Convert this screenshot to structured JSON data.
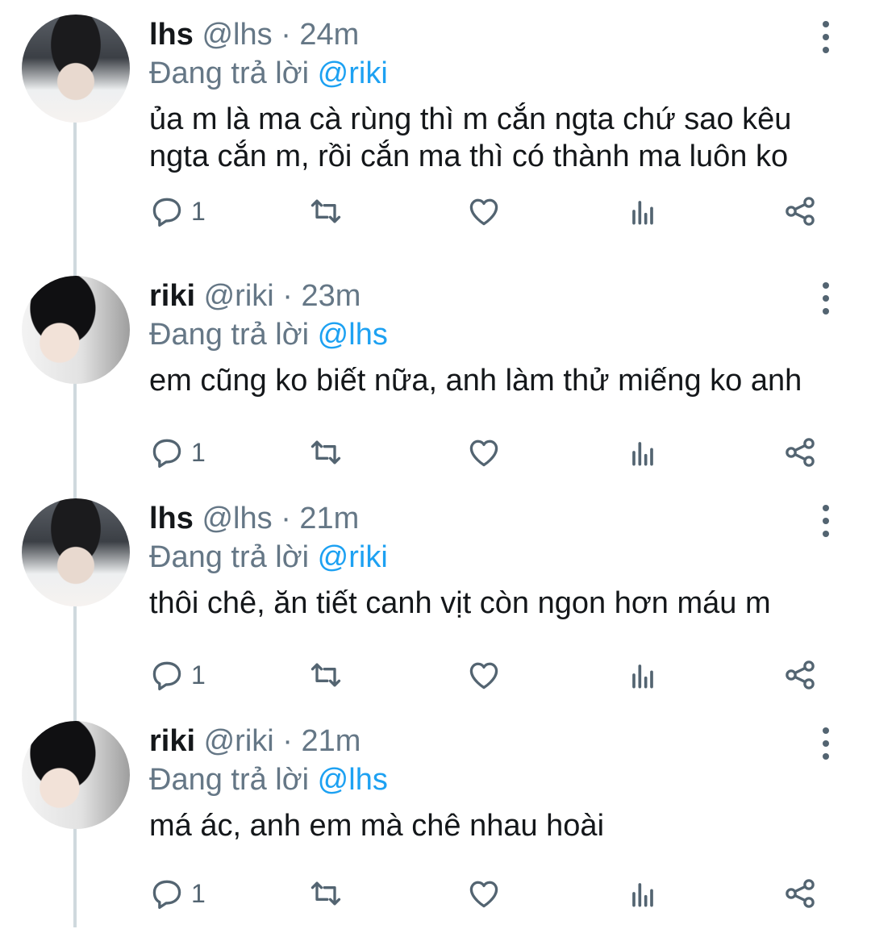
{
  "tweets": [
    {
      "name": "lhs",
      "handle": "@lhs",
      "time": "24m",
      "reply_prefix": "Đang trả lời",
      "reply_to": "@riki",
      "text": "ủa m là ma cà rùng thì m cắn ngta chứ sao kêu ngta cắn m, rồi cắn ma thì có thành ma luôn ko",
      "reply_count": "1"
    },
    {
      "name": "riki",
      "handle": "@riki",
      "time": "23m",
      "reply_prefix": "Đang trả lời",
      "reply_to": "@lhs",
      "text": "em cũng ko biết nữa, anh làm thử miếng ko anh",
      "reply_count": "1"
    },
    {
      "name": "lhs",
      "handle": "@lhs",
      "time": "21m",
      "reply_prefix": "Đang trả lời",
      "reply_to": "@riki",
      "text": "thôi chê, ăn tiết canh vịt còn ngon hơn máu m",
      "reply_count": "1"
    },
    {
      "name": "riki",
      "handle": "@riki",
      "time": "21m",
      "reply_prefix": "Đang trả lời",
      "reply_to": "@lhs",
      "text": "má ác, anh em mà chê nhau hoài",
      "reply_count": "1"
    }
  ],
  "separator": "·",
  "icons": [
    "reply-icon",
    "retweet-icon",
    "like-icon",
    "analytics-icon",
    "share-icon",
    "more-icon"
  ],
  "colors": {
    "mention": "#1da1f2",
    "meta": "#657786",
    "icon": "#536471",
    "thread_line": "#cfd9de"
  }
}
